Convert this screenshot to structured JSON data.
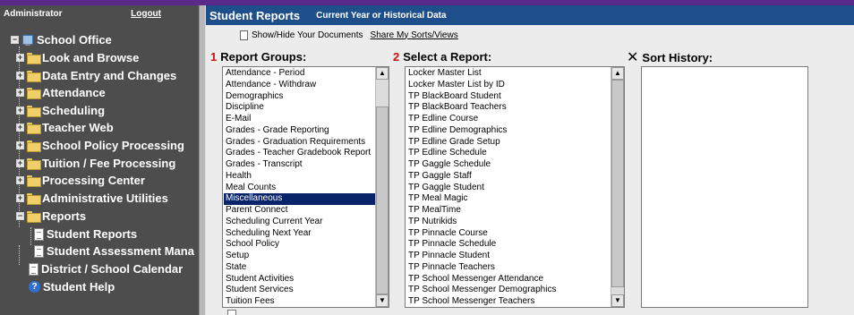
{
  "sidebar": {
    "user": "Administrator",
    "logout": "Logout",
    "tree": {
      "root": "School Office",
      "folders": [
        "Look and Browse",
        "Data Entry and Changes",
        "Attendance",
        "Scheduling",
        "Teacher Web",
        "School Policy Processing",
        "Tuition / Fee Processing",
        "Processing Center",
        "Administrative Utilities",
        "Reports"
      ],
      "report_children": [
        "Student Reports",
        "Student Assessment Mana"
      ],
      "extra": [
        "District / School Calendar",
        "Student Help"
      ]
    }
  },
  "header": {
    "title": "Student Reports",
    "subtitle": "Current Year or Historical Data"
  },
  "toolbar": {
    "show_hide": "Show/Hide Your Documents",
    "share": "Share My Sorts/Views"
  },
  "report_groups": {
    "number": "1",
    "label": "Report Groups:",
    "selected": "Miscellaneous",
    "items": [
      "Attendance - Period",
      "Attendance - Withdraw",
      "Demographics",
      "Discipline",
      "E-Mail",
      "Grades - Grade Reporting",
      "Grades - Graduation Requirements",
      "Grades - Teacher Gradebook Report",
      "Grades - Transcript",
      "Health",
      "Meal Counts",
      "Miscellaneous",
      "Parent Connect",
      "Scheduling Current Year",
      "Scheduling Next Year",
      "School Policy",
      "Setup",
      "State",
      "Student Activities",
      "Student Services",
      "Tuition Fees"
    ]
  },
  "select_report": {
    "number": "2",
    "label": "Select a Report:",
    "items": [
      "Locker Master List",
      "Locker Master List by ID",
      "TP BlackBoard Student",
      "TP BlackBoard Teachers",
      "TP Edline Course",
      "TP Edline Demographics",
      "TP Edline Grade Setup",
      "TP Edline Schedule",
      "TP Gaggle Schedule",
      "TP Gaggle Staff",
      "TP Gaggle Student",
      "TP Meal Magic",
      "TP MealTime",
      "TP Nutrikids",
      "TP Pinnacle Course",
      "TP Pinnacle Schedule",
      "TP Pinnacle Student",
      "TP Pinnacle Teachers",
      "TP School Messenger Attendance",
      "TP School Messenger Demographics",
      "TP School Messenger Teachers"
    ]
  },
  "sort_history": {
    "label": "Sort History:",
    "clear_icon": "x-icon"
  }
}
